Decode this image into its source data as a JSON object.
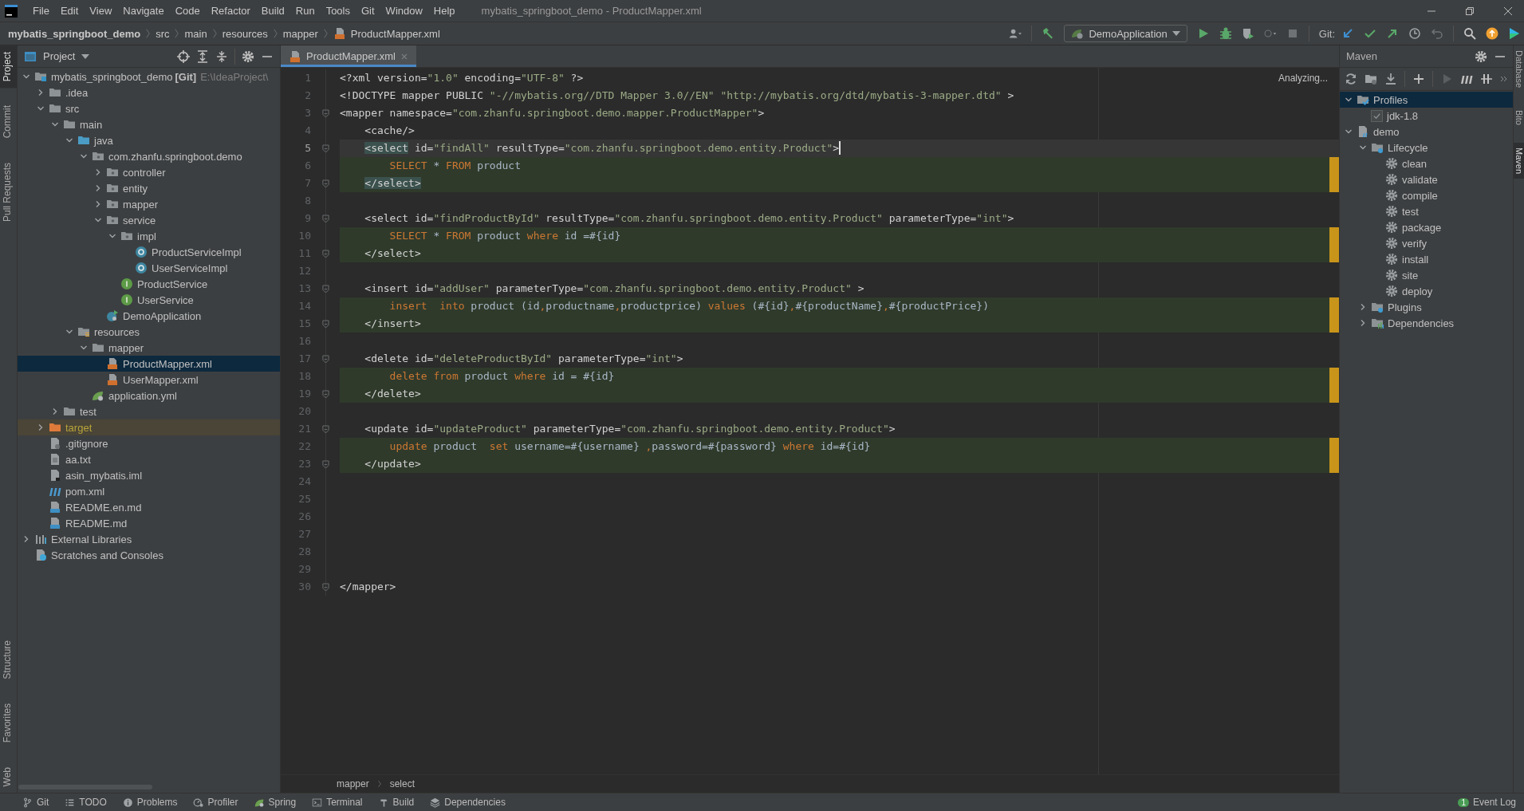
{
  "window": {
    "title": "mybatis_springboot_demo - ProductMapper.xml"
  },
  "menu": [
    "File",
    "Edit",
    "View",
    "Navigate",
    "Code",
    "Refactor",
    "Build",
    "Run",
    "Tools",
    "Git",
    "Window",
    "Help"
  ],
  "breadcrumb": [
    {
      "label": "mybatis_springboot_demo",
      "kind": "project"
    },
    {
      "label": "src",
      "kind": "folder"
    },
    {
      "label": "main",
      "kind": "folder"
    },
    {
      "label": "resources",
      "kind": "folder"
    },
    {
      "label": "mapper",
      "kind": "folder"
    },
    {
      "label": "ProductMapper.xml",
      "kind": "xml"
    }
  ],
  "run_configuration": "DemoApplication",
  "git_label": "Git:",
  "left_strip": {
    "top": [
      {
        "label": "Project",
        "selected": true
      },
      {
        "label": "Commit",
        "selected": false
      },
      {
        "label": "Pull Requests",
        "selected": false
      }
    ],
    "bottom": [
      {
        "label": "Structure",
        "selected": false
      },
      {
        "label": "Favorites",
        "selected": false
      },
      {
        "label": "Web",
        "selected": false
      }
    ]
  },
  "project_panel": {
    "title": "Project",
    "tree": [
      {
        "label": "mybatis_springboot_demo",
        "badge": "[Git]",
        "path": "E:\\IdeaProject\\",
        "kind": "module",
        "expanded": true,
        "selected": false,
        "children": [
          {
            "label": ".idea",
            "kind": "folder",
            "expanded": false,
            "selected": false
          },
          {
            "label": "src",
            "kind": "folder",
            "expanded": true,
            "selected": false,
            "children": [
              {
                "label": "main",
                "kind": "folder",
                "expanded": true,
                "selected": false,
                "children": [
                  {
                    "label": "java",
                    "kind": "source_folder",
                    "expanded": true,
                    "selected": false,
                    "children": [
                      {
                        "label": "com.zhanfu.springboot.demo",
                        "kind": "package",
                        "expanded": true,
                        "selected": false,
                        "children": [
                          {
                            "label": "controller",
                            "kind": "package",
                            "expanded": false,
                            "selected": false
                          },
                          {
                            "label": "entity",
                            "kind": "package",
                            "expanded": false,
                            "selected": false
                          },
                          {
                            "label": "mapper",
                            "kind": "package",
                            "expanded": false,
                            "selected": false
                          },
                          {
                            "label": "service",
                            "kind": "package",
                            "expanded": true,
                            "selected": false,
                            "children": [
                              {
                                "label": "impl",
                                "kind": "package",
                                "expanded": true,
                                "selected": false,
                                "children": [
                                  {
                                    "label": "ProductServiceImpl",
                                    "kind": "class",
                                    "selected": false
                                  },
                                  {
                                    "label": "UserServiceImpl",
                                    "kind": "class",
                                    "selected": false
                                  }
                                ]
                              },
                              {
                                "label": "ProductService",
                                "kind": "interface",
                                "selected": false
                              },
                              {
                                "label": "UserService",
                                "kind": "interface",
                                "selected": false
                              }
                            ]
                          },
                          {
                            "label": "DemoApplication",
                            "kind": "app",
                            "selected": false
                          }
                        ]
                      }
                    ]
                  },
                  {
                    "label": "resources",
                    "kind": "resource_folder",
                    "expanded": true,
                    "selected": false,
                    "children": [
                      {
                        "label": "mapper",
                        "kind": "folder",
                        "expanded": true,
                        "selected": false,
                        "children": [
                          {
                            "label": "ProductMapper.xml",
                            "kind": "xml",
                            "selected": true
                          },
                          {
                            "label": "UserMapper.xml",
                            "kind": "xml",
                            "selected": false
                          }
                        ]
                      },
                      {
                        "label": "application.yml",
                        "kind": "yml",
                        "selected": false
                      }
                    ]
                  }
                ]
              },
              {
                "label": "test",
                "kind": "folder",
                "expanded": false,
                "selected": false
              }
            ]
          },
          {
            "label": "target",
            "kind": "excluded_folder",
            "expanded": false,
            "excluded": true,
            "selected": false
          },
          {
            "label": ".gitignore",
            "kind": "gitignore",
            "selected": false
          },
          {
            "label": "aa.txt",
            "kind": "file",
            "selected": false
          },
          {
            "label": "asin_mybatis.iml",
            "kind": "iml",
            "selected": false
          },
          {
            "label": "pom.xml",
            "kind": "pom",
            "selected": false
          },
          {
            "label": "README.en.md",
            "kind": "markdown",
            "selected": false
          },
          {
            "label": "README.md",
            "kind": "markdown",
            "selected": false
          }
        ]
      },
      {
        "label": "External Libraries",
        "kind": "libraries",
        "expanded": false,
        "selected": false
      },
      {
        "label": "Scratches and Consoles",
        "kind": "scratches",
        "selected": false
      }
    ]
  },
  "editor": {
    "tabs": [
      {
        "label": "ProductMapper.xml",
        "selected": true
      }
    ],
    "status": "Analyzing...",
    "lines": [
      {
        "number": "1",
        "tokens": [
          {
            "kind": "markup",
            "text": "<?xml version="
          },
          {
            "kind": "value",
            "text": "\"1.0\""
          },
          {
            "kind": "markup",
            "text": " encoding="
          },
          {
            "kind": "value",
            "text": "\"UTF-8\""
          },
          {
            "kind": "markup",
            "text": " ?>"
          }
        ]
      },
      {
        "number": "2",
        "tokens": [
          {
            "kind": "markup",
            "text": "<!DOCTYPE mapper PUBLIC "
          },
          {
            "kind": "value",
            "text": "\"-//mybatis.org//DTD Mapper 3.0//EN\" "
          },
          {
            "kind": "value",
            "text": "\"http://mybatis.org/dtd/mybatis-3-mapper.dtd\""
          },
          {
            "kind": "markup",
            "text": " >"
          }
        ]
      },
      {
        "number": "3",
        "fold": true,
        "tokens": [
          {
            "kind": "markup",
            "text": "<mapper namespace="
          },
          {
            "kind": "value",
            "text": "\"com.zhanfu.springboot.demo.mapper.ProductMapper\""
          },
          {
            "kind": "markup",
            "text": ">"
          }
        ]
      },
      {
        "number": "4",
        "tokens": [
          {
            "kind": "markup",
            "text": "    <cache/>"
          }
        ]
      },
      {
        "number": "5",
        "fold": true,
        "current": true,
        "cursor": true,
        "tokens": [
          {
            "kind": "matched",
            "text": "    <select"
          },
          {
            "kind": "markup",
            "text": " id="
          },
          {
            "kind": "value",
            "text": "\"findAll\""
          },
          {
            "kind": "markup",
            "text": " resultType="
          },
          {
            "kind": "value",
            "text": "\"com.zhanfu.springboot.demo.entity.Product\""
          },
          {
            "kind": "markup",
            "text": ">"
          }
        ]
      },
      {
        "number": "6",
        "highlighted": true,
        "tokens": [
          {
            "kind": "keyword",
            "text": "        SELECT"
          },
          {
            "kind": "text",
            "text": " * "
          },
          {
            "kind": "keyword",
            "text": "FROM"
          },
          {
            "kind": "text",
            "text": " product"
          }
        ]
      },
      {
        "number": "7",
        "fold": true,
        "highlighted": true,
        "tokens": [
          {
            "kind": "matched",
            "text": "    </select>"
          }
        ]
      },
      {
        "number": "8"
      },
      {
        "number": "9",
        "fold": true,
        "tokens": [
          {
            "kind": "markup",
            "text": "    <select id="
          },
          {
            "kind": "value",
            "text": "\"findProductById\""
          },
          {
            "kind": "markup",
            "text": " resultType="
          },
          {
            "kind": "value",
            "text": "\"com.zhanfu.springboot.demo.entity.Product\""
          },
          {
            "kind": "markup",
            "text": " parameterType="
          },
          {
            "kind": "value",
            "text": "\"int\""
          },
          {
            "kind": "markup",
            "text": ">"
          }
        ]
      },
      {
        "number": "10",
        "highlighted": true,
        "tokens": [
          {
            "kind": "keyword",
            "text": "        SELECT"
          },
          {
            "kind": "text",
            "text": " * "
          },
          {
            "kind": "keyword",
            "text": "FROM"
          },
          {
            "kind": "text",
            "text": " product "
          },
          {
            "kind": "keyword",
            "text": "where"
          },
          {
            "kind": "text",
            "text": " id =#{id}"
          }
        ]
      },
      {
        "number": "11",
        "fold": true,
        "highlighted": true,
        "tokens": [
          {
            "kind": "markup",
            "text": "    </select>"
          }
        ]
      },
      {
        "number": "12"
      },
      {
        "number": "13",
        "fold": true,
        "tokens": [
          {
            "kind": "markup",
            "text": "    <insert id="
          },
          {
            "kind": "value",
            "text": "\"addUser\""
          },
          {
            "kind": "markup",
            "text": " parameterType="
          },
          {
            "kind": "value",
            "text": "\"com.zhanfu.springboot.demo.entity.Product\""
          },
          {
            "kind": "markup",
            "text": " >"
          }
        ]
      },
      {
        "number": "14",
        "highlighted": true,
        "tokens": [
          {
            "kind": "keyword",
            "text": "        insert  into"
          },
          {
            "kind": "text",
            "text": " product (id"
          },
          {
            "kind": "keyword",
            "text": ","
          },
          {
            "kind": "text",
            "text": "productname"
          },
          {
            "kind": "keyword",
            "text": ","
          },
          {
            "kind": "text",
            "text": "productprice) "
          },
          {
            "kind": "keyword",
            "text": "values"
          },
          {
            "kind": "text",
            "text": " (#{id}"
          },
          {
            "kind": "keyword",
            "text": ","
          },
          {
            "kind": "text",
            "text": "#{productName}"
          },
          {
            "kind": "keyword",
            "text": ","
          },
          {
            "kind": "text",
            "text": "#{productPrice})"
          }
        ]
      },
      {
        "number": "15",
        "fold": true,
        "highlighted": true,
        "tokens": [
          {
            "kind": "markup",
            "text": "    </insert>"
          }
        ]
      },
      {
        "number": "16"
      },
      {
        "number": "17",
        "fold": true,
        "tokens": [
          {
            "kind": "markup",
            "text": "    <delete id="
          },
          {
            "kind": "value",
            "text": "\"deleteProductById\""
          },
          {
            "kind": "markup",
            "text": " parameterType="
          },
          {
            "kind": "value",
            "text": "\"int\""
          },
          {
            "kind": "markup",
            "text": ">"
          }
        ]
      },
      {
        "number": "18",
        "highlighted": true,
        "tokens": [
          {
            "kind": "keyword",
            "text": "        delete from"
          },
          {
            "kind": "text",
            "text": " product "
          },
          {
            "kind": "keyword",
            "text": "where"
          },
          {
            "kind": "text",
            "text": " id = #{id}"
          }
        ]
      },
      {
        "number": "19",
        "fold": true,
        "highlighted": true,
        "tokens": [
          {
            "kind": "markup",
            "text": "    </delete>"
          }
        ]
      },
      {
        "number": "20"
      },
      {
        "number": "21",
        "fold": true,
        "tokens": [
          {
            "kind": "markup",
            "text": "    <update id="
          },
          {
            "kind": "value",
            "text": "\"updateProduct\""
          },
          {
            "kind": "markup",
            "text": " parameterType="
          },
          {
            "kind": "value",
            "text": "\"com.zhanfu.springboot.demo.entity.Product\""
          },
          {
            "kind": "markup",
            "text": ">"
          }
        ]
      },
      {
        "number": "22",
        "highlighted": true,
        "tokens": [
          {
            "kind": "keyword",
            "text": "        update"
          },
          {
            "kind": "text",
            "text": " product  "
          },
          {
            "kind": "keyword",
            "text": "set"
          },
          {
            "kind": "text",
            "text": " username=#{username} "
          },
          {
            "kind": "keyword",
            "text": ","
          },
          {
            "kind": "text",
            "text": "password=#{password} "
          },
          {
            "kind": "keyword",
            "text": "where"
          },
          {
            "kind": "text",
            "text": " id=#{id}"
          }
        ]
      },
      {
        "number": "23",
        "fold": true,
        "highlighted": true,
        "tokens": [
          {
            "kind": "markup",
            "text": "    </update>"
          }
        ]
      },
      {
        "number": "24"
      },
      {
        "number": "25"
      },
      {
        "number": "26"
      },
      {
        "number": "27"
      },
      {
        "number": "28"
      },
      {
        "number": "29"
      },
      {
        "number": "30",
        "fold": true,
        "tokens": [
          {
            "kind": "markup",
            "text": "</mapper>"
          }
        ]
      }
    ],
    "breadcrumb": [
      "mapper",
      "select"
    ]
  },
  "maven_panel": {
    "title": "Maven",
    "tree": [
      {
        "label": "Profiles",
        "kind": "profiles",
        "expanded": true,
        "selected": true,
        "children": [
          {
            "label": "jdk-1.8",
            "checked": true,
            "selected": false
          }
        ]
      },
      {
        "label": "demo",
        "kind": "maven_module",
        "expanded": true,
        "selected": false,
        "children": [
          {
            "label": "Lifecycle",
            "kind": "maven_folder",
            "expanded": true,
            "selected": false,
            "children": [
              {
                "label": "clean",
                "kind": "gear",
                "selected": false
              },
              {
                "label": "validate",
                "kind": "gear",
                "selected": false
              },
              {
                "label": "compile",
                "kind": "gear",
                "selected": false
              },
              {
                "label": "test",
                "kind": "gear",
                "selected": false
              },
              {
                "label": "package",
                "kind": "gear",
                "selected": false
              },
              {
                "label": "verify",
                "kind": "gear",
                "selected": false
              },
              {
                "label": "install",
                "kind": "gear",
                "selected": false
              },
              {
                "label": "site",
                "kind": "gear",
                "selected": false
              },
              {
                "label": "deploy",
                "kind": "gear",
                "selected": false
              }
            ]
          },
          {
            "label": "Plugins",
            "kind": "maven_folder",
            "expanded": false,
            "selected": false
          },
          {
            "label": "Dependencies",
            "kind": "dependencies",
            "expanded": false,
            "selected": false
          }
        ]
      }
    ]
  },
  "right_strip": [
    {
      "label": "Database",
      "selected": false
    },
    {
      "label": "Bito",
      "selected": false
    },
    {
      "label": "Maven",
      "selected": true
    }
  ],
  "bottom_bar": {
    "tools": [
      {
        "label": "Git",
        "kind": "branch"
      },
      {
        "label": "TODO",
        "kind": "list"
      },
      {
        "label": "Problems",
        "kind": "info"
      },
      {
        "label": "Profiler",
        "kind": "profiler"
      },
      {
        "label": "Spring",
        "kind": "yml"
      },
      {
        "label": "Terminal",
        "kind": "terminal"
      },
      {
        "label": "Build",
        "kind": "hammer"
      },
      {
        "label": "Dependencies",
        "kind": "layers"
      }
    ],
    "event_log": {
      "label": "Event Log",
      "count": "1"
    }
  }
}
